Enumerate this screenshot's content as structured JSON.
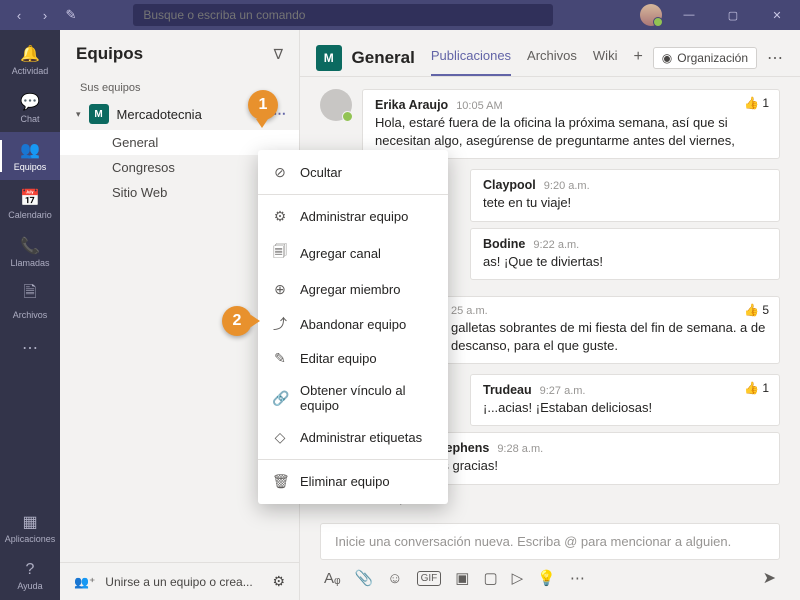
{
  "titlebar": {
    "search_placeholder": "Busque o escriba un comando"
  },
  "rail": {
    "items": [
      {
        "label": "Actividad"
      },
      {
        "label": "Chat"
      },
      {
        "label": "Equipos"
      },
      {
        "label": "Calendario"
      },
      {
        "label": "Llamadas"
      },
      {
        "label": "Archivos"
      }
    ],
    "apps": "Aplicaciones",
    "help": "Ayuda"
  },
  "sidebar": {
    "title": "Equipos",
    "section": "Sus equipos",
    "team": {
      "initial": "M",
      "name": "Mercadotecnia"
    },
    "channels": [
      {
        "name": "General"
      },
      {
        "name": "Congresos"
      },
      {
        "name": "Sitio Web"
      }
    ],
    "join": "Unirse a un equipo o crea..."
  },
  "channel_header": {
    "tile": "M",
    "name": "General",
    "tabs": [
      {
        "label": "Publicaciones"
      },
      {
        "label": "Archivos"
      },
      {
        "label": "Wiki"
      }
    ],
    "org": "Organización"
  },
  "context_menu": {
    "items": [
      {
        "icon": "⊘",
        "label": "Ocultar"
      },
      {
        "sep": true
      },
      {
        "icon": "⚙",
        "label": "Administrar equipo"
      },
      {
        "icon": "🗐",
        "label": "Agregar canal"
      },
      {
        "icon": "⊕",
        "label": "Agregar miembro"
      },
      {
        "icon": "⤴",
        "label": "Abandonar equipo"
      },
      {
        "icon": "✎",
        "label": "Editar equipo"
      },
      {
        "icon": "🔗",
        "label": "Obtener vínculo al equipo"
      },
      {
        "icon": "◇",
        "label": "Administrar etiquetas"
      },
      {
        "sep": true
      },
      {
        "icon": "🗑",
        "label": "Eliminar equipo"
      }
    ]
  },
  "messages": {
    "m0": {
      "name": "Erika Araujo",
      "time": "10:05 AM",
      "body": "Hola, estaré fuera de la oficina la próxima semana, así que si necesitan algo, asegúrense de preguntarme antes del viernes,",
      "react": "1"
    },
    "r1": {
      "name": "Claypool",
      "time": "9:20 a.m.",
      "body": "tete en tu viaje!"
    },
    "r2": {
      "name": "Bodine",
      "time": "9:22 a.m.",
      "body": "as! ¡Que te diviertas!"
    },
    "m1": {
      "time": "25 a.m.",
      "body": "galletas sobrantes de mi fiesta del fin de semana. a de descanso, para el que guste.",
      "react": "5"
    },
    "r3": {
      "name": "Trudeau",
      "time": "9:27 a.m.",
      "body": "¡...acias! ¡Estaban deliciosas!",
      "react": "1"
    },
    "r4": {
      "name": "Reed Stephens",
      "time": "9:28 a.m.",
      "body": "¡Muchas gracias!"
    },
    "reply": "Responder"
  },
  "compose": {
    "placeholder": "Inicie una conversación nueva. Escriba @ para mencionar a alguien."
  },
  "callouts": {
    "c1": "1",
    "c2": "2"
  }
}
